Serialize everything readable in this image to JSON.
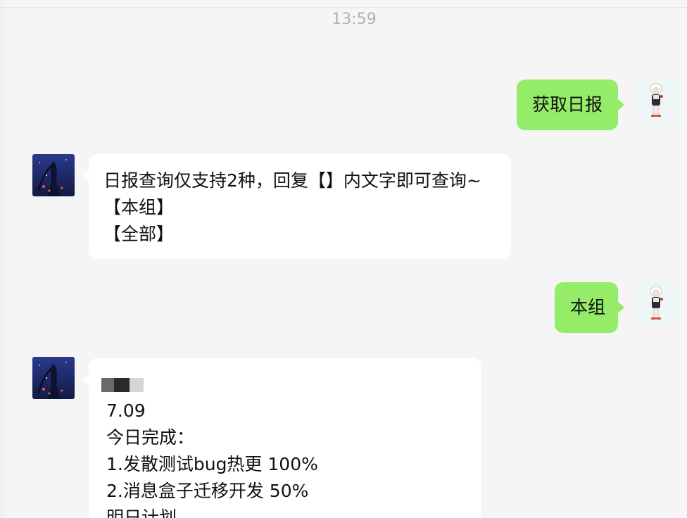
{
  "timestamp": "13:59",
  "messages": [
    {
      "sender": "self",
      "text": "获取日报"
    },
    {
      "sender": "bot",
      "lines": [
        "日报查询仅支持2种，回复【】内文字即可查询~",
        "【本组】",
        "【全部】"
      ]
    },
    {
      "sender": "self",
      "text": "本组"
    },
    {
      "sender": "bot",
      "lines": [
        "7.09",
        "今日完成：",
        "1.发散测试bug热更 100%",
        "2.消息盒子迁移开发 50%",
        "明日计划"
      ]
    }
  ],
  "colors": {
    "background": "#f5f5f5",
    "self_bubble": "#95ec69",
    "bot_bubble": "#ffffff",
    "timestamp": "#b2b2b2"
  }
}
